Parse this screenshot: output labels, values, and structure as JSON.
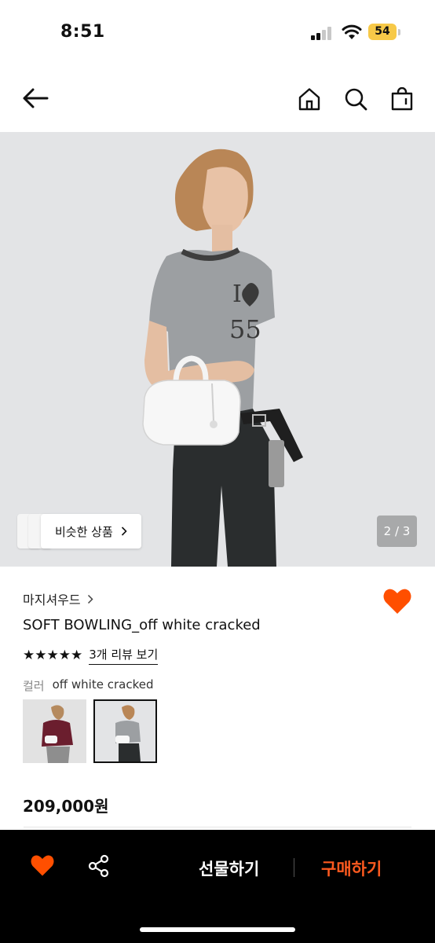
{
  "status_bar": {
    "time": "8:51",
    "battery": "54",
    "icons": [
      "signal-icon",
      "wifi-icon",
      "battery-icon"
    ]
  },
  "header": {
    "icons": [
      "back-arrow-icon",
      "home-icon",
      "search-icon",
      "shopping-bag-icon"
    ]
  },
  "gallery": {
    "similar_label": "비슷한 상품",
    "page_indicator": "2 / 3"
  },
  "product": {
    "brand": "마지셔우드",
    "name": "SOFT BOWLING_off white cracked",
    "rating_stars": "★★★★★",
    "rating_value": 5,
    "review_link": "3개 리뷰 보기",
    "color_label": "컬러",
    "color_value": "off white cracked",
    "price": "209,000원",
    "swatch_count": 2,
    "selected_swatch": 1
  },
  "bottom_bar": {
    "gift_label": "선물하기",
    "buy_label": "구매하기"
  },
  "colors": {
    "accent": "#ff5a1f",
    "heart": "#ff4f00",
    "bar_background": "#000000",
    "image_background": "#e3e4e6",
    "battery": "#f7c948"
  }
}
